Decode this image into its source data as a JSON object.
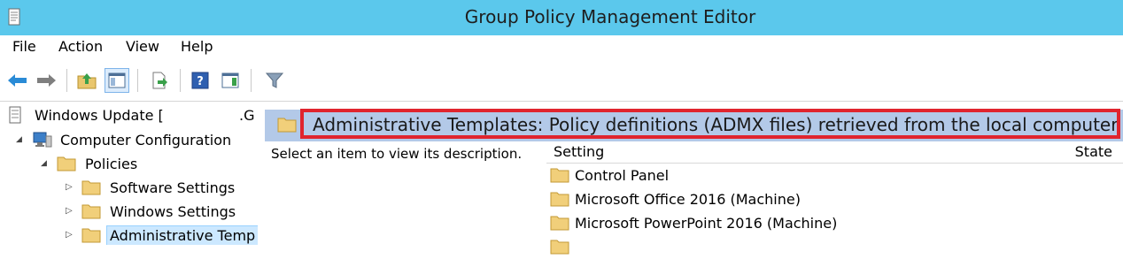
{
  "window": {
    "title": "Group Policy Management Editor"
  },
  "menu": [
    "File",
    "Action",
    "View",
    "Help"
  ],
  "toolbar": {
    "buttons": [
      "back-icon",
      "forward-icon",
      "up-folder-icon",
      "show-hide-tree-icon",
      "export-list-icon",
      "help-icon",
      "show-action-pane-icon",
      "filter-icon"
    ]
  },
  "tree": {
    "root": "Windows Update [",
    "root_suffix": ".G",
    "computer_configuration": "Computer Configuration",
    "policies": "Policies",
    "software_settings": "Software Settings",
    "windows_settings": "Windows Settings",
    "administrative_templates": "Administrative Temp"
  },
  "details": {
    "header": "Administrative Templates: Policy definitions (ADMX files) retrieved from the local computer.",
    "description_prompt": "Select an item to view its description.",
    "columns": {
      "setting": "Setting",
      "state": "State"
    },
    "items": [
      "Control Panel",
      "Microsoft Office 2016 (Machine)",
      "Microsoft PowerPoint 2016 (Machine)"
    ]
  },
  "colors": {
    "titlebar": "#5bc8ec",
    "header_band": "#b3c9e8",
    "highlight_box": "#e0242e"
  }
}
